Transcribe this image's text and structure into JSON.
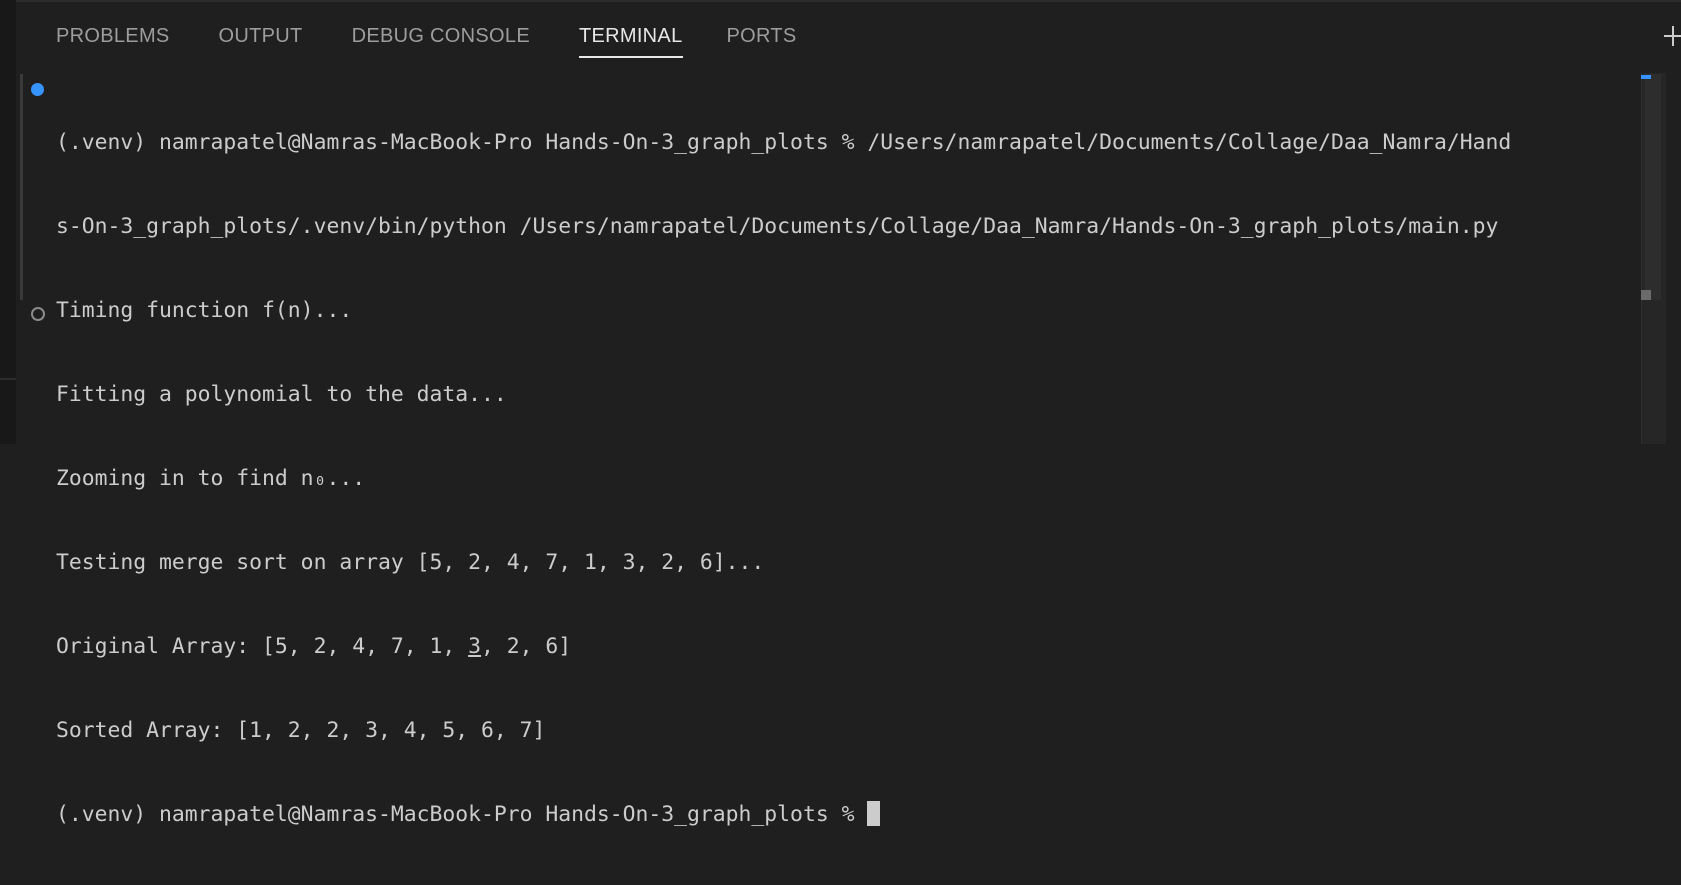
{
  "tabs": [
    {
      "label": "PROBLEMS",
      "active": false
    },
    {
      "label": "OUTPUT",
      "active": false
    },
    {
      "label": "DEBUG CONSOLE",
      "active": false
    },
    {
      "label": "TERMINAL",
      "active": true
    },
    {
      "label": "PORTS",
      "active": false
    }
  ],
  "icons": {
    "maximize": "maximize-panel-icon",
    "command_success": "command-success-decoration-icon",
    "command_idle": "command-idle-decoration-icon"
  },
  "colors": {
    "background": "#1f1f1f",
    "text": "#cccccc",
    "active_tab": "#e7e7e7",
    "inactive_tab": "#9d9d9d",
    "accent": "#3794ff"
  },
  "terminal": {
    "lines": [
      "(.venv) namrapatel@Namras-MacBook-Pro Hands-On-3_graph_plots % /Users/namrapatel/Documents/Collage/Daa_Namra/Hand",
      "s-On-3_graph_plots/.venv/bin/python /Users/namrapatel/Documents/Collage/Daa_Namra/Hands-On-3_graph_plots/main.py",
      "Timing function f(n)...",
      "Fitting a polynomial to the data...",
      "Zooming in to find n₀...",
      "Testing merge sort on array [5, 2, 4, 7, 1, 3, 2, 6]...",
      "Original Array: [5, 2, 4, 7, 1, ",
      "3",
      ", 2, 6]",
      "Sorted Array: [1, 2, 2, 3, 4, 5, 6, 7]"
    ],
    "prompt": "(.venv) namrapatel@Namras-MacBook-Pro Hands-On-3_graph_plots % "
  }
}
